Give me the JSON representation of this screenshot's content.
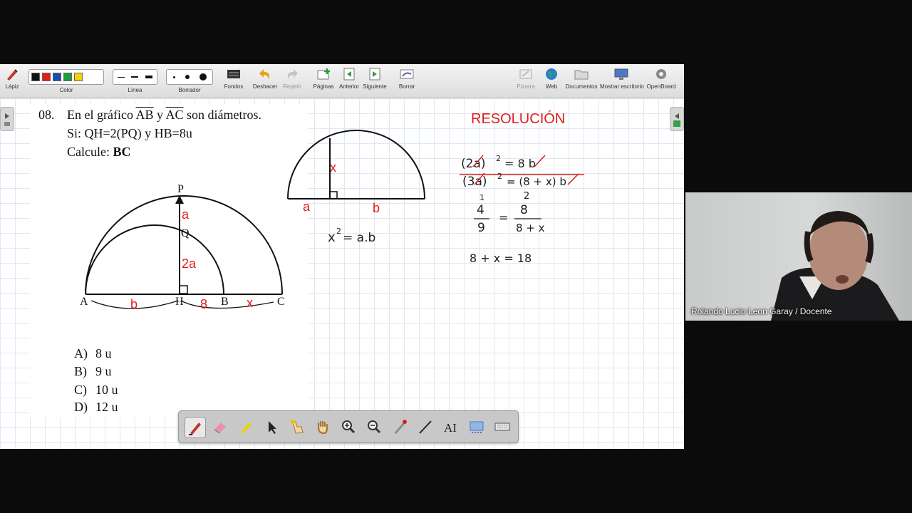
{
  "toolbar": {
    "pen": "Lápiz",
    "color": "Color",
    "line": "Línea",
    "eraser": "Borrador",
    "background": "Fondos",
    "undo": "Deshacer",
    "redo": "Repetir",
    "pages": "Páginas",
    "previous": "Anterior",
    "next": "Siguiente",
    "clear": "Borrar",
    "board": "Pizarra",
    "web": "Web",
    "documents": "Documentos",
    "desktop": "Mostrar escritorio",
    "openboard": "OpenBoard",
    "colors": [
      "#111111",
      "#e31b1b",
      "#1a4fb0",
      "#1e9e3a",
      "#f2d300"
    ]
  },
  "problem": {
    "number": "08.",
    "line1_pre": "En el gráfico",
    "seg1": "AB",
    "conj": "y",
    "seg2": "AC",
    "line1_post": "son diámetros.",
    "line2": "Si: QH=2(PQ) y HB=8u",
    "line3_pre": "Calcule:",
    "line3_bold": "BC",
    "options": [
      {
        "letter": "A)",
        "text": "8 u"
      },
      {
        "letter": "B)",
        "text": "9 u"
      },
      {
        "letter": "C)",
        "text": "10 u"
      },
      {
        "letter": "D)",
        "text": "12 u"
      }
    ]
  },
  "figure": {
    "P": "P",
    "Q": "Q",
    "A": "A",
    "H": "H",
    "B": "B",
    "C": "C",
    "a": "a",
    "two_a": "2a",
    "b": "b",
    "eight": "8",
    "x": "x"
  },
  "semicircle": {
    "x": "x",
    "a": "a",
    "b": "b",
    "formula_base": "x",
    "formula_exp": "2",
    "formula_rest": "= a.b"
  },
  "resolution": {
    "title": "RESOLUCIÓN",
    "l1_left": "(2a)",
    "l1_exp": "2",
    "l1_right": "= 8 b",
    "l2_left": "(3a)",
    "l2_exp": "2",
    "l2_right": "= (8 + x) b",
    "small_1": "1",
    "small_2": "2",
    "frac1_num": "4",
    "frac1_den": "9",
    "eq": "=",
    "frac2_num": "8",
    "frac2_den": "8 + x",
    "last": "8 + x = 18"
  },
  "video": {
    "name": "Rolando Lucio Leon Garay / Docente"
  },
  "colors": {
    "accent_red": "#e01b1b",
    "ink": "#222222"
  }
}
